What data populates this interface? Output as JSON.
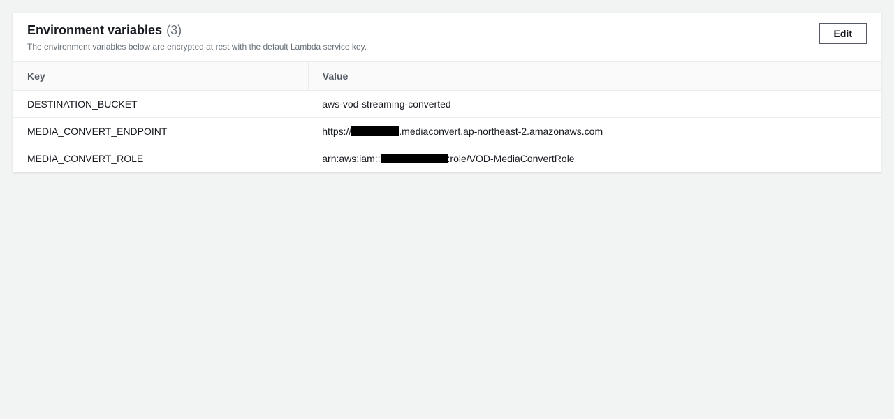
{
  "panel": {
    "title": "Environment variables",
    "count": "(3)",
    "subtitle": "The environment variables below are encrypted at rest with the default Lambda service key.",
    "edit_label": "Edit"
  },
  "table": {
    "columns": {
      "key": "Key",
      "value": "Value"
    },
    "rows": [
      {
        "key": "DESTINATION_BUCKET",
        "value_pre": "aws-vod-streaming-converted",
        "value_post": "",
        "redacted": false
      },
      {
        "key": "MEDIA_CONVERT_ENDPOINT",
        "value_pre": "https://",
        "value_post": ".mediaconvert.ap-northeast-2.amazonaws.com",
        "redacted": true,
        "rclass": "r1"
      },
      {
        "key": "MEDIA_CONVERT_ROLE",
        "value_pre": "arn:aws:iam::",
        "value_post": ":role/VOD-MediaConvertRole",
        "redacted": true,
        "rclass": "r2"
      }
    ]
  }
}
